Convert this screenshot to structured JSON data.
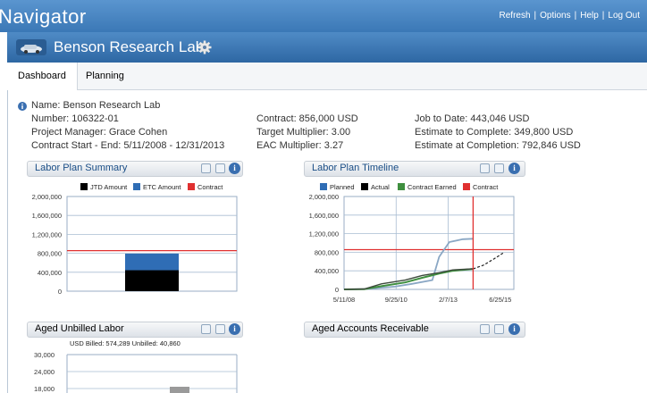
{
  "app": {
    "title": "Navigator",
    "links": [
      "Refresh",
      "Options",
      "Help",
      "Log Out"
    ],
    "link_separator": "|"
  },
  "lab": {
    "name": "Benson Research Lab"
  },
  "tabs": [
    {
      "label": "Dashboard",
      "active": true
    },
    {
      "label": "Planning",
      "active": false
    }
  ],
  "project": {
    "name": "Name: Benson Research Lab",
    "number": "Number: 106322-01",
    "manager": "Project Manager: Grace Cohen",
    "dates": "Contract Start - End:  5/11/2008 - 12/31/2013",
    "contract": "Contract: 856,000 USD",
    "target_multiplier": "Target Multiplier:  3.00",
    "eac_multiplier": "EAC Multiplier: 3.27",
    "job_to_date": "Job to Date: 443,046 USD",
    "estimate_to_complete": "Estimate to Complete: 349,800 USD",
    "estimate_at_completion": "Estimate at Completion: 792,846 USD"
  },
  "panels": {
    "labor_plan_summary": "Labor Plan Summary",
    "labor_plan_timeline": "Labor Plan Timeline",
    "aged_unbilled_labor": "Aged Unbilled Labor",
    "aged_accounts_receivable": "Aged Accounts Receivable"
  },
  "colors": {
    "accent": "#3b78b6",
    "jtd": "#000000",
    "etc": "#2f6db5",
    "contract": "#e03030",
    "planned": "#8aa7c4",
    "actual": "#3d4a3d",
    "earned": "#3f8f3f"
  },
  "chart_data": [
    {
      "type": "bar",
      "stacked": true,
      "categories": [
        ""
      ],
      "series": [
        {
          "name": "JTD Amount",
          "values": [
            443046
          ]
        },
        {
          "name": "ETC Amount",
          "values": [
            349800
          ]
        }
      ],
      "reference_line": {
        "name": "Contract",
        "value": 856000
      },
      "yticks": [
        "2,000,000",
        "1,600,000",
        "1,200,000",
        "800,000",
        "400,000",
        "0"
      ],
      "ylim": [
        0,
        2000000
      ],
      "legend": "top"
    },
    {
      "type": "line",
      "series_names": [
        "Planned",
        "Actual",
        "Contract Earned",
        "Contract"
      ],
      "xticks": [
        "5/11/08",
        "9/25/10",
        "2/7/13",
        "6/25/15"
      ],
      "yticks": [
        "2,000,000",
        "1,600,000",
        "1,200,000",
        "800,000",
        "400,000",
        "0"
      ],
      "ylim": [
        0,
        2000000
      ],
      "planned": [
        [
          0,
          0
        ],
        [
          0.12,
          8000
        ],
        [
          0.3,
          60000
        ],
        [
          0.4,
          120000
        ],
        [
          0.52,
          200000
        ],
        [
          0.56,
          700000
        ],
        [
          0.62,
          1020000
        ],
        [
          0.7,
          1080000
        ],
        [
          0.76,
          1090000
        ]
      ],
      "actual": [
        [
          0,
          0
        ],
        [
          0.12,
          10000
        ],
        [
          0.22,
          120000
        ],
        [
          0.36,
          200000
        ],
        [
          0.46,
          300000
        ],
        [
          0.56,
          360000
        ],
        [
          0.64,
          420000
        ],
        [
          0.76,
          443046
        ]
      ],
      "earned": [
        [
          0,
          0
        ],
        [
          0.12,
          5000
        ],
        [
          0.22,
          70000
        ],
        [
          0.36,
          150000
        ],
        [
          0.46,
          250000
        ],
        [
          0.56,
          340000
        ],
        [
          0.64,
          400000
        ],
        [
          0.76,
          440000
        ]
      ],
      "forecast": [
        [
          0.76,
          443046
        ],
        [
          0.82,
          520000
        ],
        [
          0.88,
          650000
        ],
        [
          0.94,
          790000
        ]
      ],
      "contract_value": 856000,
      "today_marker": 0.76,
      "legend": "top"
    },
    {
      "type": "bar",
      "subtitle": "USD    Billed: 574,289    Unbilled: 40,860",
      "yticks": [
        "30,000",
        "24,000",
        "18,000"
      ],
      "ylim": [
        0,
        30000
      ]
    }
  ]
}
